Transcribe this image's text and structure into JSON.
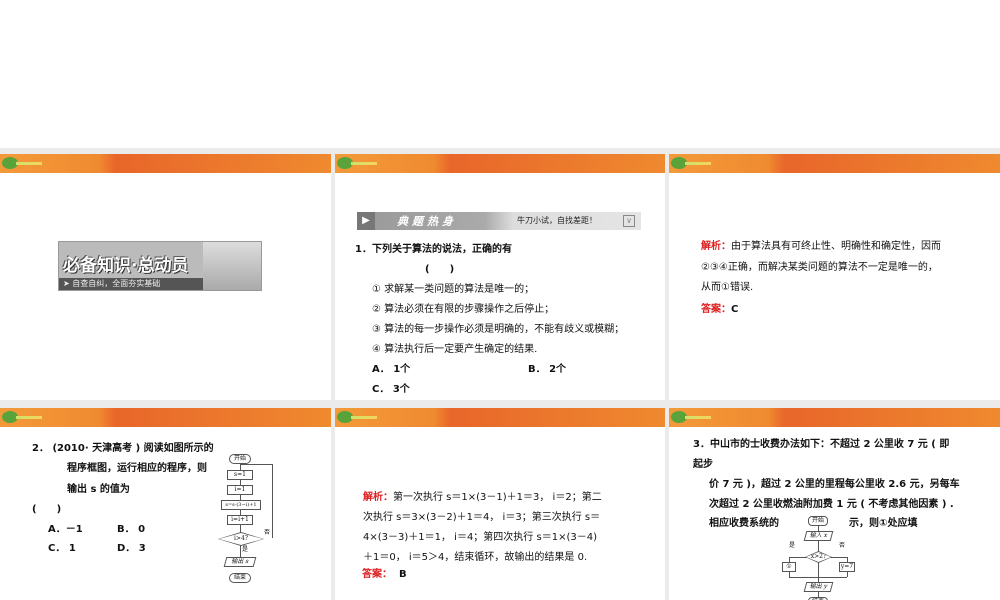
{
  "slide1": {
    "banner_title": "必备知识·总动员",
    "banner_subtitle": "➤ 自查自纠，全面夯实基础"
  },
  "slide2": {
    "header_title": "典题热身",
    "header_subtitle": "牛刀小试，自找差距！",
    "question": "1．下列关于算法的说法，正确的有",
    "bracket": "(　　)",
    "items": [
      "① 求解某一类问题的算法是唯一的；",
      "② 算法必须在有限的步骤操作之后停止；",
      "③ 算法的每一步操作必须是明确的，不能有歧义或模糊；",
      "④ 算法执行后一定要产生确定的结果."
    ],
    "options": [
      "A． 1个",
      "B． 2个",
      "C． 3个"
    ]
  },
  "slide3": {
    "analysis_label": "解析：",
    "analysis_lines": [
      "由于算法具有可终止性、明确性和确定性，因而",
      "②③④正确，而解决某类问题的算法不一定是唯一的，",
      "从而①错误."
    ],
    "answer_label": "答案：",
    "answer": "C"
  },
  "slide4": {
    "question_lines": [
      "2． (2010· 天津高考 ) 阅读如图所示的",
      "程序框图，运行相应的程序，则",
      "输出 s 的值为"
    ],
    "bracket": "(　　)",
    "options": [
      "A．－1",
      "B． 0",
      "C． 1",
      "D． 3"
    ],
    "flow": [
      "开始",
      "s=1",
      "i=1",
      "s=s·(3−i)+1",
      "i=i+1",
      "i>4?",
      "否",
      "是",
      "输出 s",
      "结束"
    ]
  },
  "slide5": {
    "analysis_label": "解析：",
    "analysis_lines": [
      "第一次执行 s＝1×(3－1)＋1＝3， i＝2；第二",
      "次执行 s＝3×(3－2)＋1＝4， i＝3；第三次执行 s＝",
      "4×(3－3)＋1＝1， i＝4；第四次执行 s＝1×(3－4)",
      "＋1＝0， i＝5＞4，结束循环，故输出的结果是 0."
    ],
    "answer_label": "答案：",
    "answer": "B"
  },
  "slide6": {
    "question_lines": [
      "3．中山市的士收费办法如下：不超过 2 公里收 7 元 ( 即",
      "起步",
      "价 7 元 )，超过 2 公里的里程每公里收 2.6 元，另每车",
      "次超过 2 公里收燃油附加费 1 元 ( 不考虑其他因素 ) .",
      "相应收费系统的",
      "示，则①处应填"
    ],
    "flow": [
      "开始",
      "输入 x",
      "x>2?",
      "是",
      "否",
      "①",
      "y=7",
      "输出 y",
      "结束"
    ]
  }
}
